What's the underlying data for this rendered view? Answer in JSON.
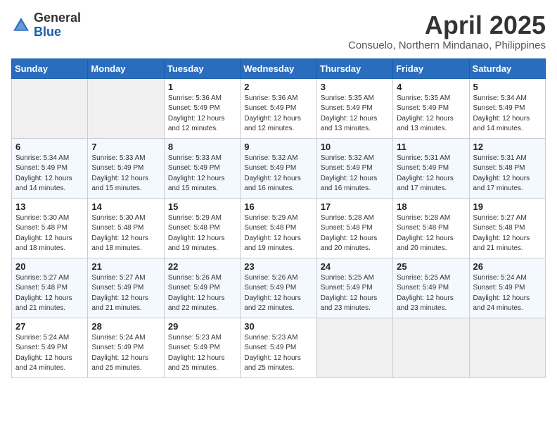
{
  "header": {
    "logo_general": "General",
    "logo_blue": "Blue",
    "month_title": "April 2025",
    "location": "Consuelo, Northern Mindanao, Philippines"
  },
  "weekdays": [
    "Sunday",
    "Monday",
    "Tuesday",
    "Wednesday",
    "Thursday",
    "Friday",
    "Saturday"
  ],
  "weeks": [
    [
      {
        "day": "",
        "sunrise": "",
        "sunset": "",
        "daylight": ""
      },
      {
        "day": "",
        "sunrise": "",
        "sunset": "",
        "daylight": ""
      },
      {
        "day": "1",
        "sunrise": "Sunrise: 5:36 AM",
        "sunset": "Sunset: 5:49 PM",
        "daylight": "Daylight: 12 hours and 12 minutes."
      },
      {
        "day": "2",
        "sunrise": "Sunrise: 5:36 AM",
        "sunset": "Sunset: 5:49 PM",
        "daylight": "Daylight: 12 hours and 12 minutes."
      },
      {
        "day": "3",
        "sunrise": "Sunrise: 5:35 AM",
        "sunset": "Sunset: 5:49 PM",
        "daylight": "Daylight: 12 hours and 13 minutes."
      },
      {
        "day": "4",
        "sunrise": "Sunrise: 5:35 AM",
        "sunset": "Sunset: 5:49 PM",
        "daylight": "Daylight: 12 hours and 13 minutes."
      },
      {
        "day": "5",
        "sunrise": "Sunrise: 5:34 AM",
        "sunset": "Sunset: 5:49 PM",
        "daylight": "Daylight: 12 hours and 14 minutes."
      }
    ],
    [
      {
        "day": "6",
        "sunrise": "Sunrise: 5:34 AM",
        "sunset": "Sunset: 5:49 PM",
        "daylight": "Daylight: 12 hours and 14 minutes."
      },
      {
        "day": "7",
        "sunrise": "Sunrise: 5:33 AM",
        "sunset": "Sunset: 5:49 PM",
        "daylight": "Daylight: 12 hours and 15 minutes."
      },
      {
        "day": "8",
        "sunrise": "Sunrise: 5:33 AM",
        "sunset": "Sunset: 5:49 PM",
        "daylight": "Daylight: 12 hours and 15 minutes."
      },
      {
        "day": "9",
        "sunrise": "Sunrise: 5:32 AM",
        "sunset": "Sunset: 5:49 PM",
        "daylight": "Daylight: 12 hours and 16 minutes."
      },
      {
        "day": "10",
        "sunrise": "Sunrise: 5:32 AM",
        "sunset": "Sunset: 5:49 PM",
        "daylight": "Daylight: 12 hours and 16 minutes."
      },
      {
        "day": "11",
        "sunrise": "Sunrise: 5:31 AM",
        "sunset": "Sunset: 5:49 PM",
        "daylight": "Daylight: 12 hours and 17 minutes."
      },
      {
        "day": "12",
        "sunrise": "Sunrise: 5:31 AM",
        "sunset": "Sunset: 5:48 PM",
        "daylight": "Daylight: 12 hours and 17 minutes."
      }
    ],
    [
      {
        "day": "13",
        "sunrise": "Sunrise: 5:30 AM",
        "sunset": "Sunset: 5:48 PM",
        "daylight": "Daylight: 12 hours and 18 minutes."
      },
      {
        "day": "14",
        "sunrise": "Sunrise: 5:30 AM",
        "sunset": "Sunset: 5:48 PM",
        "daylight": "Daylight: 12 hours and 18 minutes."
      },
      {
        "day": "15",
        "sunrise": "Sunrise: 5:29 AM",
        "sunset": "Sunset: 5:48 PM",
        "daylight": "Daylight: 12 hours and 19 minutes."
      },
      {
        "day": "16",
        "sunrise": "Sunrise: 5:29 AM",
        "sunset": "Sunset: 5:48 PM",
        "daylight": "Daylight: 12 hours and 19 minutes."
      },
      {
        "day": "17",
        "sunrise": "Sunrise: 5:28 AM",
        "sunset": "Sunset: 5:48 PM",
        "daylight": "Daylight: 12 hours and 20 minutes."
      },
      {
        "day": "18",
        "sunrise": "Sunrise: 5:28 AM",
        "sunset": "Sunset: 5:48 PM",
        "daylight": "Daylight: 12 hours and 20 minutes."
      },
      {
        "day": "19",
        "sunrise": "Sunrise: 5:27 AM",
        "sunset": "Sunset: 5:48 PM",
        "daylight": "Daylight: 12 hours and 21 minutes."
      }
    ],
    [
      {
        "day": "20",
        "sunrise": "Sunrise: 5:27 AM",
        "sunset": "Sunset: 5:48 PM",
        "daylight": "Daylight: 12 hours and 21 minutes."
      },
      {
        "day": "21",
        "sunrise": "Sunrise: 5:27 AM",
        "sunset": "Sunset: 5:49 PM",
        "daylight": "Daylight: 12 hours and 21 minutes."
      },
      {
        "day": "22",
        "sunrise": "Sunrise: 5:26 AM",
        "sunset": "Sunset: 5:49 PM",
        "daylight": "Daylight: 12 hours and 22 minutes."
      },
      {
        "day": "23",
        "sunrise": "Sunrise: 5:26 AM",
        "sunset": "Sunset: 5:49 PM",
        "daylight": "Daylight: 12 hours and 22 minutes."
      },
      {
        "day": "24",
        "sunrise": "Sunrise: 5:25 AM",
        "sunset": "Sunset: 5:49 PM",
        "daylight": "Daylight: 12 hours and 23 minutes."
      },
      {
        "day": "25",
        "sunrise": "Sunrise: 5:25 AM",
        "sunset": "Sunset: 5:49 PM",
        "daylight": "Daylight: 12 hours and 23 minutes."
      },
      {
        "day": "26",
        "sunrise": "Sunrise: 5:24 AM",
        "sunset": "Sunset: 5:49 PM",
        "daylight": "Daylight: 12 hours and 24 minutes."
      }
    ],
    [
      {
        "day": "27",
        "sunrise": "Sunrise: 5:24 AM",
        "sunset": "Sunset: 5:49 PM",
        "daylight": "Daylight: 12 hours and 24 minutes."
      },
      {
        "day": "28",
        "sunrise": "Sunrise: 5:24 AM",
        "sunset": "Sunset: 5:49 PM",
        "daylight": "Daylight: 12 hours and 25 minutes."
      },
      {
        "day": "29",
        "sunrise": "Sunrise: 5:23 AM",
        "sunset": "Sunset: 5:49 PM",
        "daylight": "Daylight: 12 hours and 25 minutes."
      },
      {
        "day": "30",
        "sunrise": "Sunrise: 5:23 AM",
        "sunset": "Sunset: 5:49 PM",
        "daylight": "Daylight: 12 hours and 25 minutes."
      },
      {
        "day": "",
        "sunrise": "",
        "sunset": "",
        "daylight": ""
      },
      {
        "day": "",
        "sunrise": "",
        "sunset": "",
        "daylight": ""
      },
      {
        "day": "",
        "sunrise": "",
        "sunset": "",
        "daylight": ""
      }
    ]
  ]
}
